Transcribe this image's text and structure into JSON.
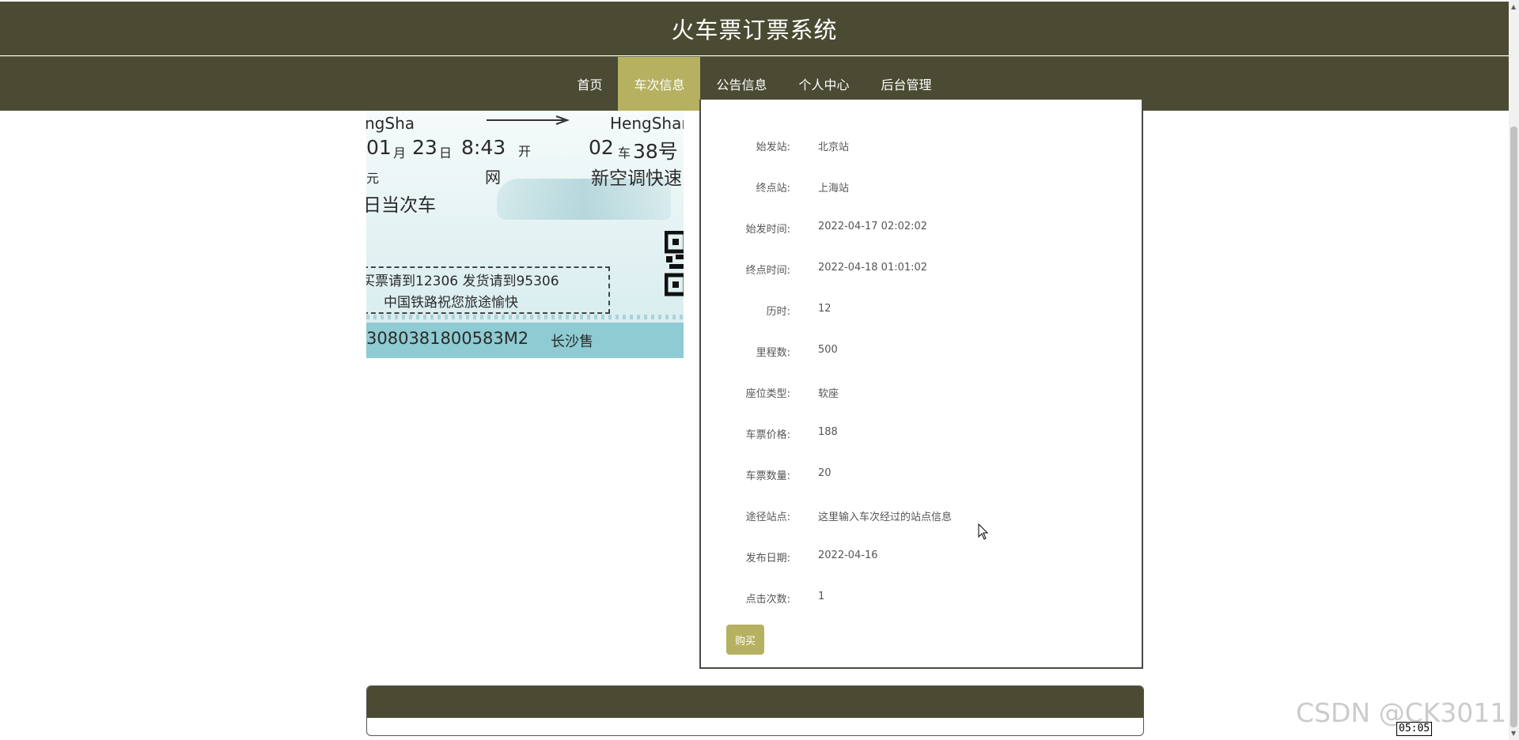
{
  "header": {
    "title": "火车票订票系统"
  },
  "nav": {
    "items": [
      {
        "label": "首页"
      },
      {
        "label": "车次信息"
      },
      {
        "label": "公告信息"
      },
      {
        "label": "个人中心"
      },
      {
        "label": "后台管理"
      }
    ],
    "active_index": 1
  },
  "ticket": {
    "from_pinyin": "ngSha",
    "to_pinyin": "HengShar",
    "date_month": "01",
    "month_char": "月",
    "date_day": "23",
    "day_char": "日",
    "time": "8:43",
    "kai": "开",
    "car": "02",
    "car_char": "车",
    "seat": "38号",
    "yuan": "元",
    "wang": "网",
    "train_type": "新空调快速",
    "validity": "日当次车",
    "notice_1": "买票请到12306  发货请到95306",
    "notice_2": "中国铁路祝您旅途愉快",
    "serial": "3080381800583M2",
    "sold_at": "长沙售"
  },
  "details": {
    "rows": [
      {
        "label": "始发站:",
        "value": "北京站"
      },
      {
        "label": "终点站:",
        "value": "上海站"
      },
      {
        "label": "始发时间:",
        "value": "2022-04-17 02:02:02"
      },
      {
        "label": "终点时间:",
        "value": "2022-04-18 01:01:02"
      },
      {
        "label": "历时:",
        "value": "12"
      },
      {
        "label": "里程数:",
        "value": "500"
      },
      {
        "label": "座位类型:",
        "value": "软座"
      },
      {
        "label": "车票价格:",
        "value": "188"
      },
      {
        "label": "车票数量:",
        "value": "20"
      },
      {
        "label": "途径站点:",
        "value": "这里输入车次经过的站点信息"
      },
      {
        "label": "发布日期:",
        "value": "2022-04-16"
      },
      {
        "label": "点击次数:",
        "value": "1"
      }
    ],
    "buy_label": "购买"
  },
  "overlay": {
    "watermark": "CSDN @CK3011",
    "time": "05:05"
  },
  "colors": {
    "header_bg": "#4b4b33",
    "accent": "#b5b160"
  }
}
